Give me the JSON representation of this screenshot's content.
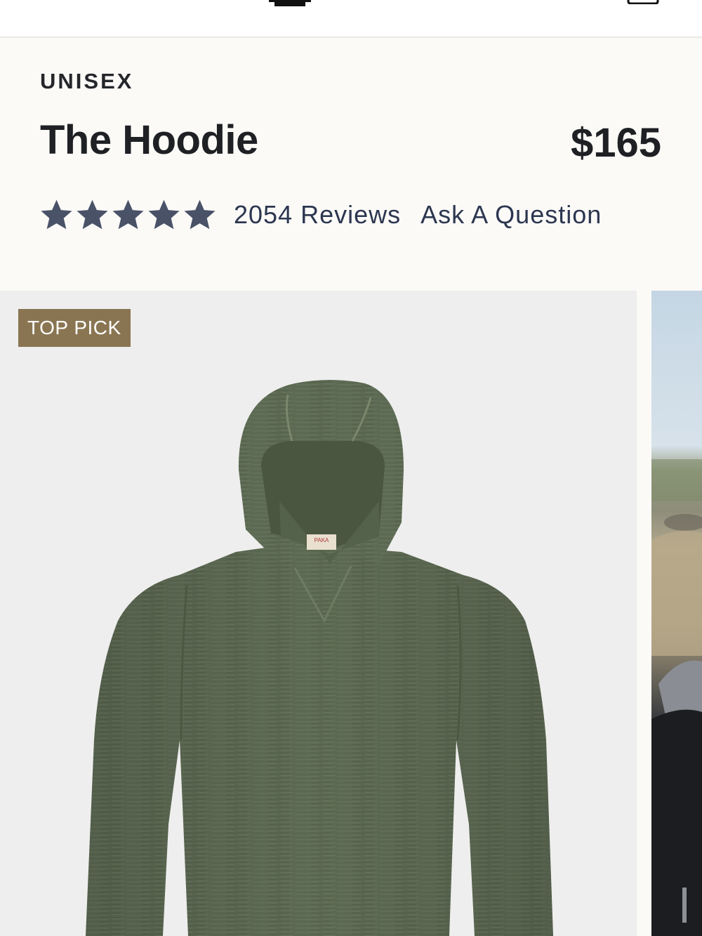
{
  "product": {
    "category": "UNISEX",
    "title": "The Hoodie",
    "price": "$165",
    "rating": {
      "stars": 5,
      "max": 5,
      "reviews_label": "2054 Reviews"
    },
    "ask_label": "Ask A Question"
  },
  "gallery": {
    "badge": "TOP PICK",
    "tag_text": "PAKA"
  },
  "colors": {
    "star": "#4a5268",
    "link": "#2c3650",
    "badge_bg": "#8a7552",
    "hoodie": "#5c6a52"
  },
  "icons": {
    "rating": "star-icon"
  }
}
